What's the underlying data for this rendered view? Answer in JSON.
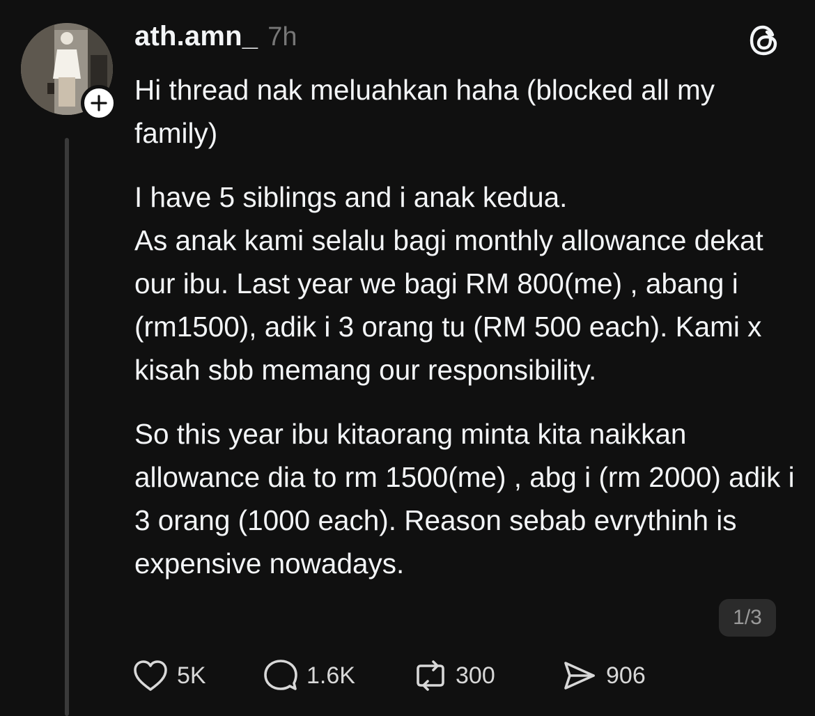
{
  "post": {
    "username": "ath.amn_",
    "timestamp": "7h",
    "paragraphs": [
      "Hi thread nak meluahkan haha (blocked all my family)",
      "I have 5 siblings and i anak kedua.",
      "As anak kami selalu bagi monthly allowance dekat our ibu. Last year we bagi RM 800(me) , abang i (rm1500), adik i 3 orang tu (RM 500 each). Kami x kisah sbb memang our responsibility.",
      "So this year ibu kitaorang minta kita naikkan allowance dia to rm 1500(me) , abg i (rm 2000) adik i 3 orang (1000 each). Reason sebab evrythinh is expensive nowadays."
    ],
    "page_indicator": "1/3"
  },
  "actions": {
    "likes": "5K",
    "replies": "1.6K",
    "reposts": "300",
    "shares": "906"
  },
  "icons": {
    "follow": "plus-icon",
    "app_logo": "threads-logo-icon",
    "like": "heart-icon",
    "reply": "speech-bubble-icon",
    "repost": "repost-arrows-icon",
    "share": "send-icon"
  },
  "colors": {
    "background": "#101010",
    "text": "#f3f5f7",
    "muted": "#777777",
    "thread_line": "#3a3a3a",
    "badge_bg": "#2b2b2b"
  }
}
